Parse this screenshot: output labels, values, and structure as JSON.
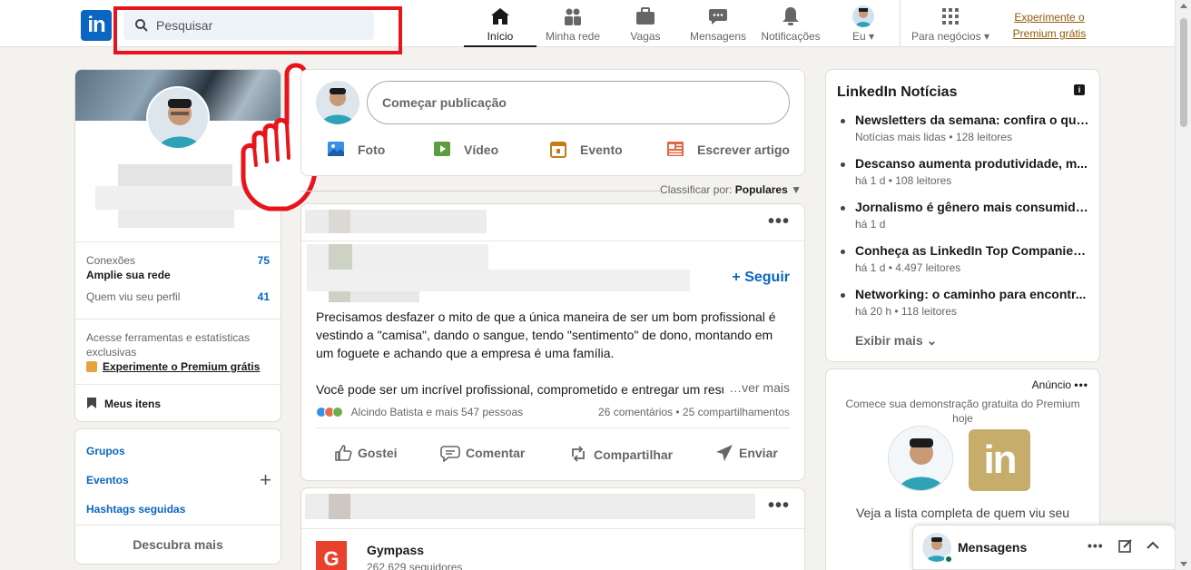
{
  "nav": {
    "logo_text": "in",
    "search_placeholder": "Pesquisar",
    "items": [
      {
        "label": "Início",
        "icon": "home-icon"
      },
      {
        "label": "Minha rede",
        "icon": "network-icon"
      },
      {
        "label": "Vagas",
        "icon": "briefcase-icon"
      },
      {
        "label": "Mensagens",
        "icon": "chat-icon"
      },
      {
        "label": "Notificações",
        "icon": "bell-icon"
      },
      {
        "label": "Eu",
        "icon": "avatar"
      },
      {
        "label": "Para negócios",
        "icon": "grid-icon"
      }
    ],
    "premium_line1": "Experimente o",
    "premium_line2": "Premium grátis"
  },
  "profile": {
    "connections_label": "Conexões",
    "connections_sub": "Amplie sua rede",
    "connections_count": "75",
    "viewers_label": "Quem viu seu perfil",
    "viewers_count": "41",
    "tools_text": "Acesse ferramentas e estatísticas exclusivas",
    "premium_cta": "Experimente o Premium grátis",
    "my_items": "Meus itens"
  },
  "left_links": {
    "groups": "Grupos",
    "events": "Eventos",
    "hashtags": "Hashtags seguidas",
    "discover": "Descubra mais"
  },
  "share": {
    "placeholder": "Começar publicação",
    "photo": "Foto",
    "video": "Vídeo",
    "event": "Evento",
    "article": "Escrever artigo"
  },
  "sort": {
    "label": "Classificar por:",
    "value": "Populares"
  },
  "post": {
    "follow": "+ Seguir",
    "text_1": "Precisamos desfazer o mito de que a única maneira de ser um bom profissional é vestindo a \"camisa\", dando o sangue, tendo \"sentimento\" de dono, montando em um foguete e achando que a empresa é uma família.",
    "text_2": "Você pode ser um incrível profissional, comprometido e entregar um resu",
    "see_more": "…ver mais",
    "reactions": "Alcindo Batista e mais 547 pessoas",
    "counts": "26 comentários • 25 compartilhamentos",
    "actions": {
      "like": "Gostei",
      "comment": "Comentar",
      "share": "Compartilhar",
      "send": "Enviar"
    }
  },
  "post2": {
    "company": "Gympass",
    "followers": "262.629 seguidores",
    "logo_letter": "G"
  },
  "news": {
    "title": "LinkedIn Notícias",
    "items": [
      {
        "headline": "Newsletters da semana: confira o que...",
        "sub": "Notícias mais lidas • 128 leitores"
      },
      {
        "headline": "Descanso aumenta produtividade, m...",
        "sub": "há 1 d • 108 leitores"
      },
      {
        "headline": "Jornalismo é gênero mais consumido ...",
        "sub": "há 1 d"
      },
      {
        "headline": "Conheça as LinkedIn Top Companies ...",
        "sub": "há 1 d • 4.497 leitores"
      },
      {
        "headline": "Networking: o caminho para encontr...",
        "sub": "há 20 h • 118 leitores"
      }
    ],
    "show_more": "Exibir mais"
  },
  "ad": {
    "label": "Anúncio",
    "text": "Comece sua demonstração gratuita do Premium hoje",
    "in_logo": "in",
    "bottom_text": "Veja a lista completa de quem viu seu"
  },
  "messaging": {
    "title": "Mensagens"
  },
  "colors": {
    "brand": "#0a66c2",
    "highlight": "#e8141b",
    "premium": "#915907"
  }
}
